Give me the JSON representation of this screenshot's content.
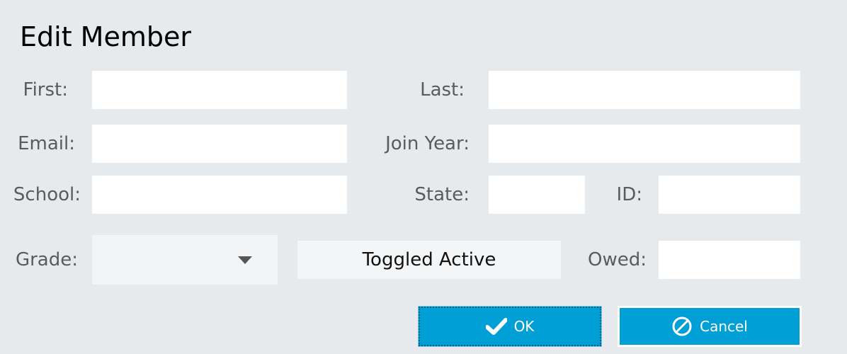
{
  "dialog": {
    "title": "Edit Member"
  },
  "form": {
    "first": {
      "label": "First:",
      "value": ""
    },
    "last": {
      "label": "Last:",
      "value": ""
    },
    "email": {
      "label": "Email:",
      "value": ""
    },
    "join_year": {
      "label": "Join Year:",
      "value": ""
    },
    "school": {
      "label": "School:",
      "value": ""
    },
    "state": {
      "label": "State:",
      "value": ""
    },
    "id": {
      "label": "ID:",
      "value": ""
    },
    "grade": {
      "label": "Grade:",
      "selected": ""
    },
    "toggle_label": "Toggled Active",
    "owed": {
      "label": "Owed:",
      "value": ""
    }
  },
  "buttons": {
    "ok_label": "OK",
    "cancel_label": "Cancel"
  },
  "icons": {
    "ok": "checkmark-icon",
    "cancel": "cancel-icon",
    "dropdown": "chevron-down-icon"
  },
  "colors": {
    "background": "#e6eaed",
    "button": "#00a0d7",
    "label": "#5b5b5b"
  }
}
